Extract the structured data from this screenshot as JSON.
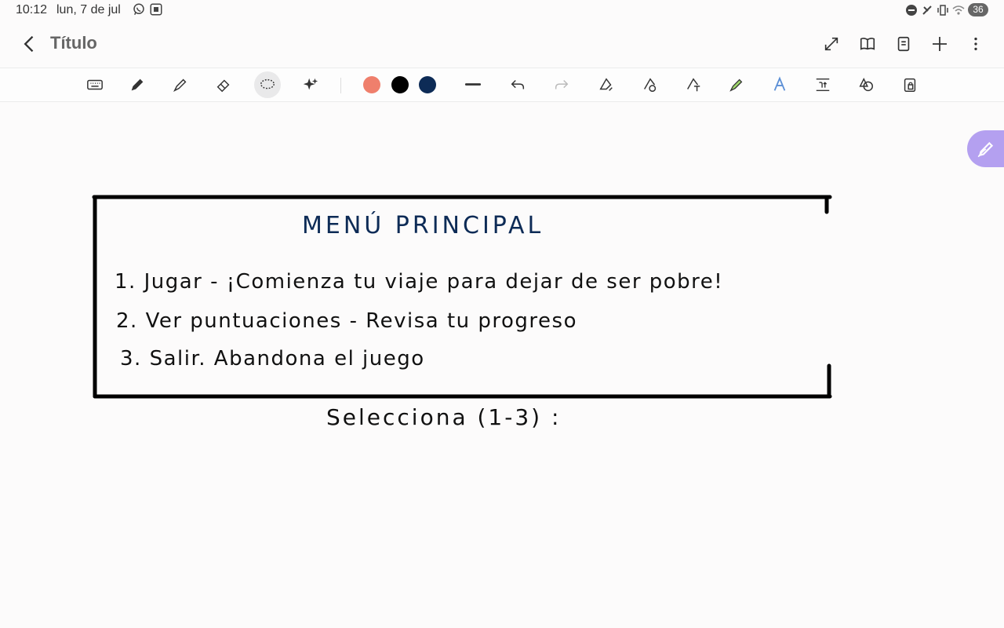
{
  "status_bar": {
    "time": "10:12",
    "date": "lun, 7 de jul",
    "battery": "36",
    "app_icons": [
      "whatsapp-icon",
      "screenshot-icon"
    ],
    "system_icons": [
      "do-not-disturb-icon",
      "mute-icon",
      "vibrate-icon",
      "wifi-icon"
    ]
  },
  "header": {
    "title": "Título",
    "actions": [
      "expand-icon",
      "book-icon",
      "page-icon",
      "add-icon",
      "more-icon"
    ]
  },
  "toolbar": {
    "tools": [
      "keyboard-icon",
      "pen-icon",
      "highlighter-icon",
      "eraser-icon",
      "lasso-icon",
      "sparkle-icon"
    ],
    "active_tool": "lasso-icon",
    "colors": [
      "#ef7f6c",
      "#000000",
      "#0d2b56"
    ],
    "more_tools": [
      "line-thickness-icon",
      "undo-icon",
      "redo-icon",
      "shape-pen-icon",
      "timer-pen-icon",
      "text-pen-icon",
      "marker-icon",
      "text-style-icon",
      "text-size-icon",
      "shapes-icon",
      "lock-icon"
    ]
  },
  "note": {
    "title": "MENÚ PRINCIPAL",
    "items": [
      "1. Jugar - ¡Comienza tu viaje para dejar de ser pobre!",
      "2. Ver puntuaciones - Revisa tu progreso",
      "3. Salir. Abandona el juego"
    ],
    "prompt": "Selecciona (1-3) :"
  },
  "colors": {
    "accent_fab": "#b4a0f0",
    "title_ink": "#0d2b56",
    "ink": "#111111"
  }
}
